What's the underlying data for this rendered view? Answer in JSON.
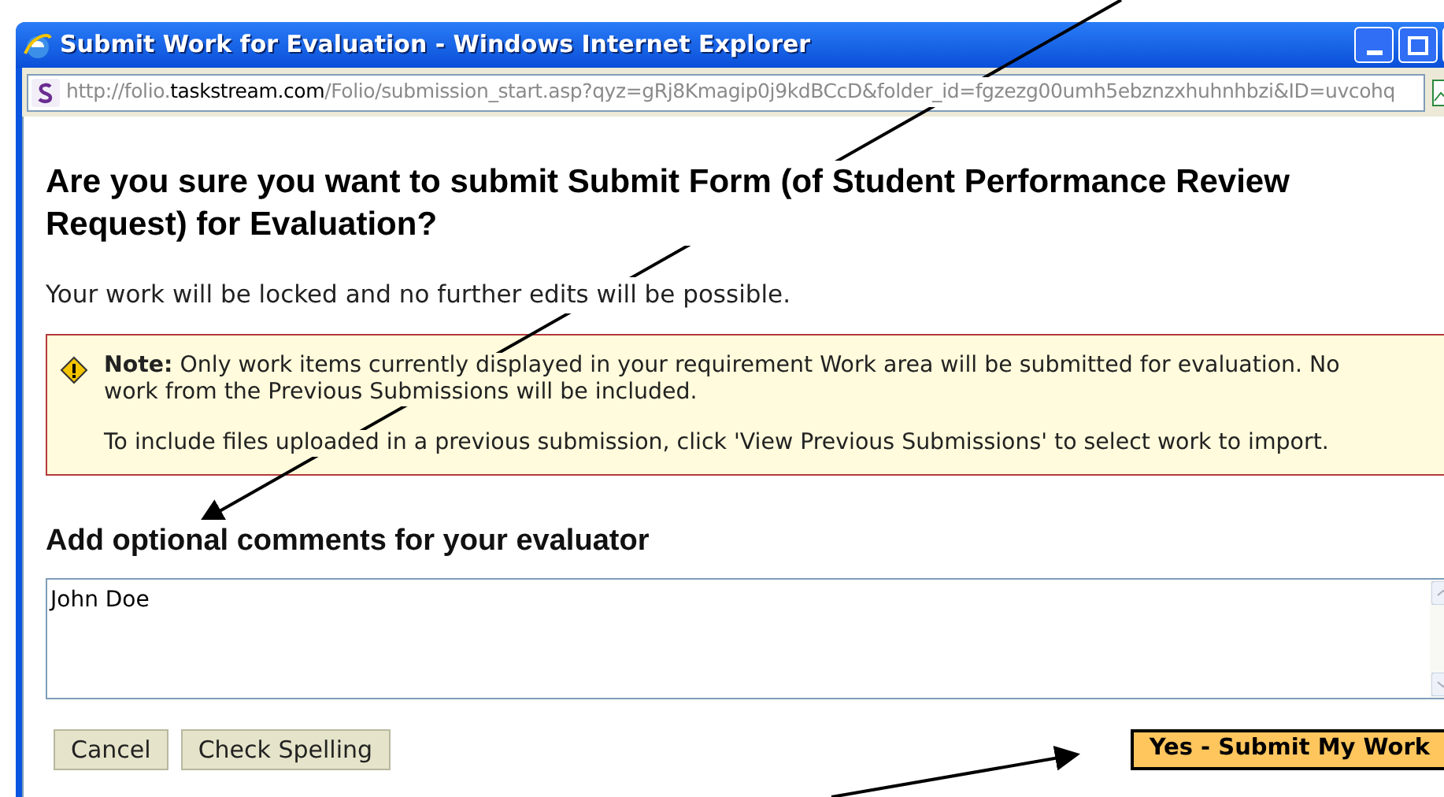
{
  "window": {
    "title": "Submit Work for Evaluation - Windows Internet Explorer"
  },
  "address_bar": {
    "parts": [
      {
        "text": "http://folio.",
        "emphasis": false
      },
      {
        "text": "taskstream.com",
        "emphasis": true
      },
      {
        "text": "/Folio/submission_start.asp?qyz=gRj8Kmagip0j9kdBCcD&folder_id=fgzezg00umh5ebznzxhuhnhbzi&ID=uvcohq",
        "emphasis": false
      }
    ]
  },
  "heading": "Are you sure you want to submit Submit Form (of Student Performance Review Request) for Evaluation?",
  "intro": "Your work will be locked and no further edits will be possible.",
  "note": {
    "paragraphs": [
      "**Note:** Only work items currently displayed in your requirement Work area will be submitted for evaluation. No work from the Previous Submissions will be included.",
      "To include files uploaded in a previous submission, click 'View Previous Submissions' to select work to import."
    ]
  },
  "comments": {
    "label": "Add optional comments for your evaluator",
    "value": "John Doe"
  },
  "buttons": [
    {
      "label": "Cancel",
      "kind": "secondary"
    },
    {
      "label": "Check Spelling",
      "kind": "secondary"
    },
    {
      "label": "Yes - Submit My Work",
      "kind": "primary"
    }
  ]
}
